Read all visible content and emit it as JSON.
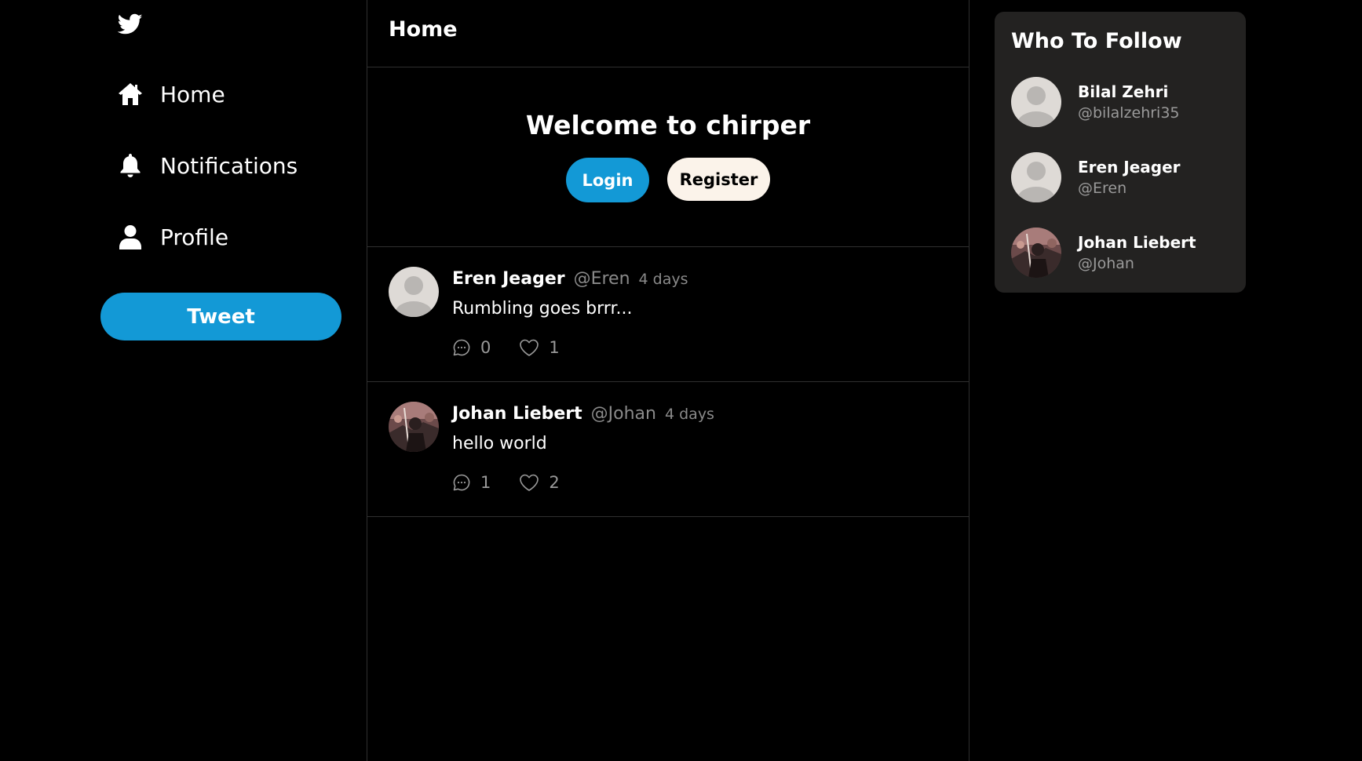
{
  "sidebar": {
    "items": [
      {
        "label": "Home",
        "icon": "home-icon"
      },
      {
        "label": "Notifications",
        "icon": "bell-icon"
      },
      {
        "label": "Profile",
        "icon": "user-icon"
      }
    ],
    "tweet_label": "Tweet"
  },
  "feed": {
    "title": "Home",
    "welcome": {
      "title": "Welcome to chirper",
      "login_label": "Login",
      "register_label": "Register"
    },
    "posts": [
      {
        "name": "Eren Jeager",
        "handle": "@Eren",
        "time": "4 days",
        "text": "Rumbling goes brrr...",
        "comments": "0",
        "likes": "1",
        "avatar": "default-avatar"
      },
      {
        "name": "Johan Liebert",
        "handle": "@Johan",
        "time": "4 days",
        "text": "hello world",
        "comments": "1",
        "likes": "2",
        "avatar": "photo-avatar"
      }
    ]
  },
  "who_to_follow": {
    "title": "Who To Follow",
    "users": [
      {
        "name": "Bilal Zehri",
        "handle": "@bilalzehri35",
        "avatar": "default-avatar"
      },
      {
        "name": "Eren Jeager",
        "handle": "@Eren",
        "avatar": "default-avatar"
      },
      {
        "name": "Johan Liebert",
        "handle": "@Johan",
        "avatar": "photo-avatar"
      }
    ]
  },
  "colors": {
    "accent": "#1399d6",
    "background": "#000000",
    "card": "#232221",
    "register_bg": "#fbf3ea",
    "muted_text": "#8a8a8a"
  }
}
